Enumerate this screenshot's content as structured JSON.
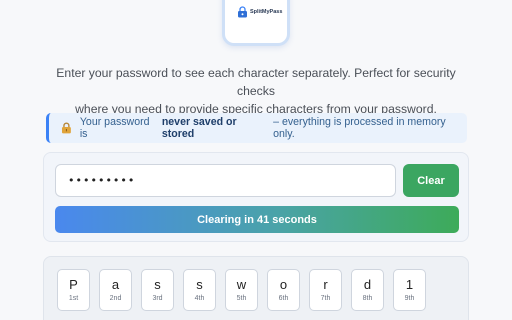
{
  "logo": {
    "text": "SplitMyPass",
    "icon": "padlock-icon"
  },
  "intro": {
    "line1": "Enter your password to see each character separately. Perfect for security checks",
    "line2": "where you need to provide specific characters from your password."
  },
  "notice": {
    "icon": "lock-icon",
    "prefix": "Your password is",
    "emphasis": "never saved or stored",
    "suffix": "– everything is processed in memory only."
  },
  "input": {
    "value": "Password1"
  },
  "clear_button": {
    "label": "Clear"
  },
  "timer": {
    "label": "Clearing in 41 seconds",
    "seconds_remaining": 41
  },
  "characters": [
    {
      "char": "P",
      "pos": "1st"
    },
    {
      "char": "a",
      "pos": "2nd"
    },
    {
      "char": "s",
      "pos": "3rd"
    },
    {
      "char": "s",
      "pos": "4th"
    },
    {
      "char": "w",
      "pos": "5th"
    },
    {
      "char": "o",
      "pos": "6th"
    },
    {
      "char": "r",
      "pos": "7th"
    },
    {
      "char": "d",
      "pos": "8th"
    },
    {
      "char": "1",
      "pos": "9th"
    }
  ],
  "colors": {
    "accent_blue": "#3b82f6",
    "clear_green": "#3ba661",
    "timer_start": "#4a88ee",
    "timer_end": "#3dab59"
  }
}
